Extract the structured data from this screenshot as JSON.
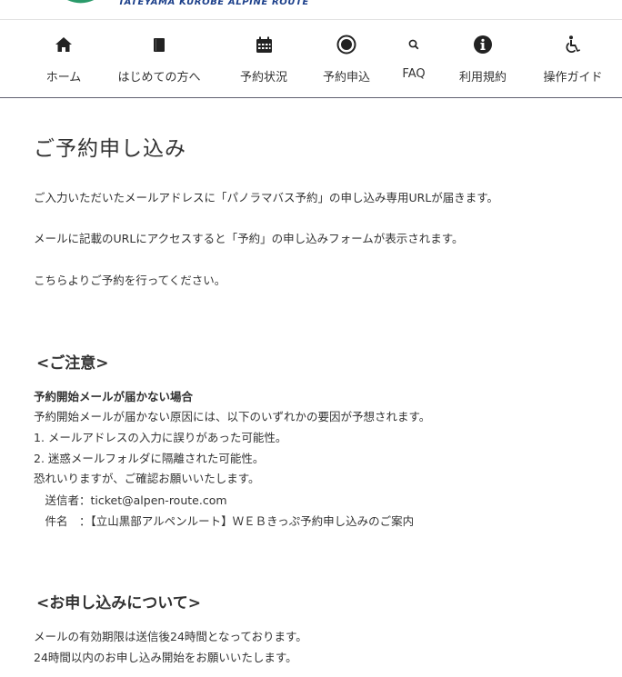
{
  "header": {
    "logo_sub": "TATEYAMA KUROBE ALPINE ROUTE",
    "brand_color": "#1b3f8a",
    "accent_color": "#2a9a6a"
  },
  "nav": [
    {
      "label": "ホーム",
      "icon": "home-icon"
    },
    {
      "label": "はじめての方へ",
      "icon": "book-icon"
    },
    {
      "label": "予約状況",
      "icon": "calendar-icon"
    },
    {
      "label": "予約申込",
      "icon": "radio-circle-icon"
    },
    {
      "label": "FAQ",
      "icon": "search-icon"
    },
    {
      "label": "利用規約",
      "icon": "info-icon"
    },
    {
      "label": "操作ガイド",
      "icon": "accessibility-icon"
    }
  ],
  "page": {
    "title": "ご予約申し込み",
    "intro": [
      "ご入力いただいたメールアドレスに「パノラマバス予約」の申し込み専用URLが届きます。",
      "メールに記載のURLにアクセスすると「予約」の申し込みフォームが表示されます。",
      "こちらよりご予約を行ってください。"
    ],
    "notice": {
      "heading": "<ご注意>",
      "subheading": "予約開始メールが届かない場合",
      "lines": [
        "予約開始メールが届かない原因には、以下のいずれかの要因が予想されます。",
        "1. メールアドレスの入力に誤りがあった可能性。",
        "2. 迷惑メールフォルダに隔離された可能性。",
        "恐れいりますが、ご確認お願いいたします。",
        "　送信者：ticket@alpen-route.com",
        "　件名　：【立山黒部アルペンルート】ＷＥＢきっぷ予約申し込みのご案内"
      ]
    },
    "application": {
      "heading": "<お申し込みについて>",
      "lines": [
        "メールの有効期限は送信後24時間となっております。",
        "24時間以内のお申し込み開始をお願いいたします。"
      ]
    }
  }
}
